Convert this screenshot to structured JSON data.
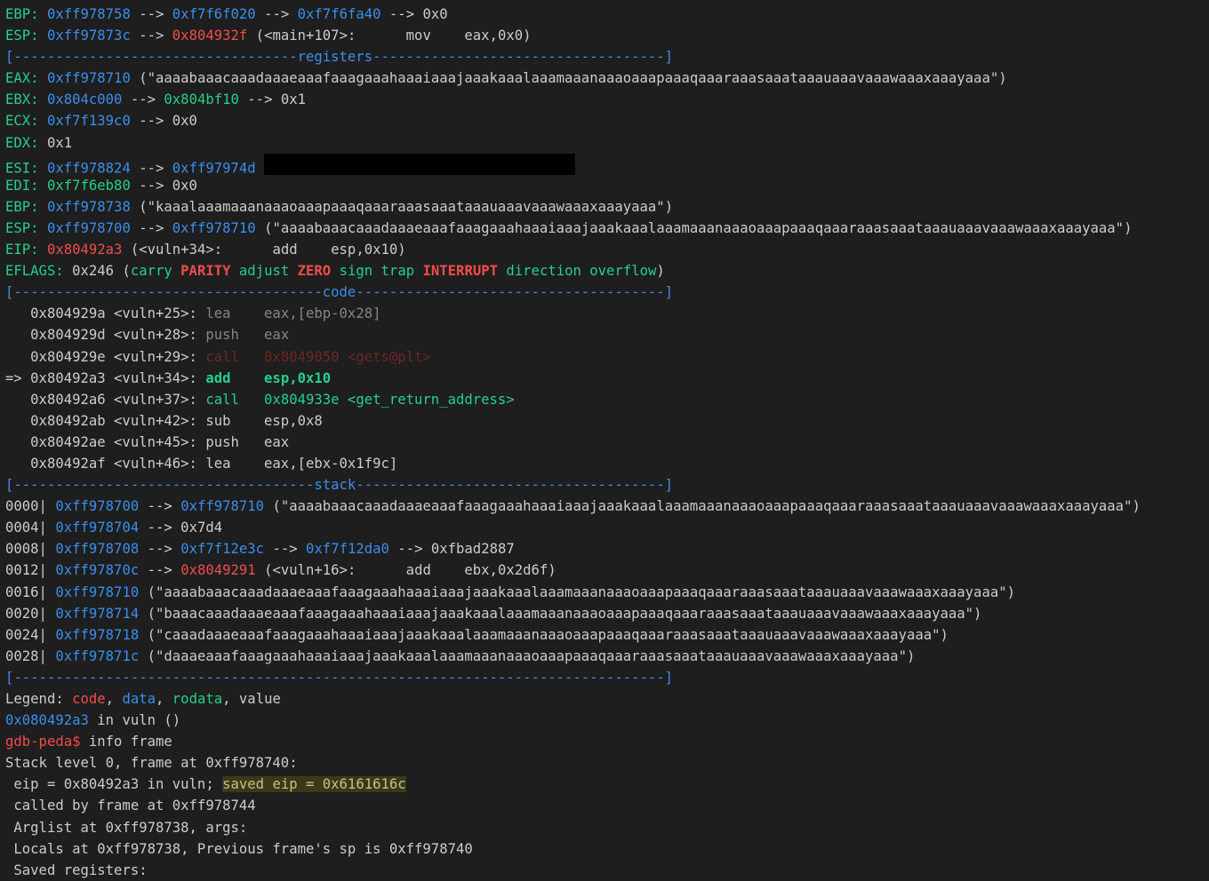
{
  "lines": [
    {
      "name": "ebp-chain",
      "interactable": false,
      "spans": [
        {
          "t": "EBP: ",
          "c": "label"
        },
        {
          "t": "0xff978758",
          "c": "blue"
        },
        {
          "t": " --> ",
          "c": "plain"
        },
        {
          "t": "0xf7f6f020",
          "c": "blue"
        },
        {
          "t": " --> ",
          "c": "plain"
        },
        {
          "t": "0xf7f6fa40",
          "c": "blue"
        },
        {
          "t": " --> 0x0",
          "c": "plain"
        }
      ]
    },
    {
      "name": "esp-chain",
      "interactable": false,
      "spans": [
        {
          "t": "ESP: ",
          "c": "label"
        },
        {
          "t": "0xff97873c",
          "c": "blue"
        },
        {
          "t": " --> ",
          "c": "plain"
        },
        {
          "t": "0x804932f",
          "c": "red"
        },
        {
          "t": " (<main+107>:      mov    eax,0x0)",
          "c": "plain"
        }
      ]
    },
    {
      "name": "registers-header",
      "interactable": false,
      "spans": [
        {
          "t": "[----------------------------------registers-----------------------------------]",
          "c": "blue"
        }
      ]
    },
    {
      "name": "reg-eax",
      "interactable": false,
      "spans": [
        {
          "t": "EAX: ",
          "c": "label"
        },
        {
          "t": "0xff978710",
          "c": "blue"
        },
        {
          "t": " (\"aaaabaaacaaadaaaeaaafaaagaaahaaaiaaajaaakaaalaaamaaanaaaoaaapaaaqaaaraaasaaataaauaaavaaawaaaxaaayaaa\")",
          "c": "plain"
        }
      ]
    },
    {
      "name": "reg-ebx",
      "interactable": false,
      "spans": [
        {
          "t": "EBX: ",
          "c": "label"
        },
        {
          "t": "0x804c000",
          "c": "blue"
        },
        {
          "t": " --> ",
          "c": "plain"
        },
        {
          "t": "0x804bf10",
          "c": "green"
        },
        {
          "t": " --> 0x1",
          "c": "plain"
        }
      ]
    },
    {
      "name": "reg-ecx",
      "interactable": false,
      "spans": [
        {
          "t": "ECX: ",
          "c": "label"
        },
        {
          "t": "0xf7f139c0",
          "c": "blue"
        },
        {
          "t": " --> 0x0",
          "c": "plain"
        }
      ]
    },
    {
      "name": "reg-edx",
      "interactable": false,
      "spans": [
        {
          "t": "EDX: ",
          "c": "label"
        },
        {
          "t": "0x1",
          "c": "plain"
        }
      ]
    },
    {
      "name": "reg-esi",
      "interactable": false,
      "spans": [
        {
          "t": "ESI: ",
          "c": "label"
        },
        {
          "t": "0xff978824",
          "c": "blue"
        },
        {
          "t": " --> ",
          "c": "plain"
        },
        {
          "t": "0xff97974d",
          "c": "blue"
        },
        {
          "t": " ",
          "c": "plain"
        },
        {
          "redact": true
        }
      ]
    },
    {
      "name": "reg-edi",
      "interactable": false,
      "spans": [
        {
          "t": "EDI: ",
          "c": "label"
        },
        {
          "t": "0xf7f6eb80",
          "c": "green"
        },
        {
          "t": " --> 0x0",
          "c": "plain"
        }
      ]
    },
    {
      "name": "reg-ebp",
      "interactable": false,
      "spans": [
        {
          "t": "EBP: ",
          "c": "label"
        },
        {
          "t": "0xff978738",
          "c": "blue"
        },
        {
          "t": " (\"kaaalaaamaaanaaaoaaapaaaqaaaraaasaaataaauaaavaaawaaaxaaayaaa\")",
          "c": "plain"
        }
      ]
    },
    {
      "name": "reg-esp",
      "interactable": false,
      "spans": [
        {
          "t": "ESP: ",
          "c": "label"
        },
        {
          "t": "0xff978700",
          "c": "blue"
        },
        {
          "t": " --> ",
          "c": "plain"
        },
        {
          "t": "0xff978710",
          "c": "blue"
        },
        {
          "t": " (\"aaaabaaacaaadaaaeaaafaaagaaahaaaiaaajaaakaaalaaamaaanaaaoaaapaaaqaaaraaasaaataaauaaavaaawaaaxaaayaaa\")",
          "c": "plain"
        }
      ]
    },
    {
      "name": "reg-eip",
      "interactable": false,
      "spans": [
        {
          "t": "EIP: ",
          "c": "label"
        },
        {
          "t": "0x80492a3",
          "c": "red"
        },
        {
          "t": " (<vuln+34>:      add    esp,0x10)",
          "c": "plain"
        }
      ]
    },
    {
      "name": "reg-eflags",
      "interactable": false,
      "spans": [
        {
          "t": "EFLAGS: ",
          "c": "label"
        },
        {
          "t": "0x246 (",
          "c": "plain"
        },
        {
          "t": "carry",
          "c": "green"
        },
        {
          "t": " ",
          "c": "plain"
        },
        {
          "t": "PARITY",
          "c": "bold-red"
        },
        {
          "t": " ",
          "c": "plain"
        },
        {
          "t": "adjust",
          "c": "green"
        },
        {
          "t": " ",
          "c": "plain"
        },
        {
          "t": "ZERO",
          "c": "bold-red"
        },
        {
          "t": " ",
          "c": "plain"
        },
        {
          "t": "sign",
          "c": "green"
        },
        {
          "t": " ",
          "c": "plain"
        },
        {
          "t": "trap",
          "c": "green"
        },
        {
          "t": " ",
          "c": "plain"
        },
        {
          "t": "INTERRUPT",
          "c": "bold-red"
        },
        {
          "t": " ",
          "c": "plain"
        },
        {
          "t": "direction",
          "c": "green"
        },
        {
          "t": " ",
          "c": "plain"
        },
        {
          "t": "overflow",
          "c": "green"
        },
        {
          "t": ")",
          "c": "plain"
        }
      ]
    },
    {
      "name": "code-header",
      "interactable": false,
      "spans": [
        {
          "t": "[-------------------------------------code-------------------------------------]",
          "c": "blue"
        }
      ]
    },
    {
      "name": "code-line",
      "interactable": false,
      "spans": [
        {
          "t": "   0x804929a <vuln+25>: ",
          "c": "plain"
        },
        {
          "t": "lea    eax,[ebp-0x28]",
          "c": "gray"
        }
      ]
    },
    {
      "name": "code-line",
      "interactable": false,
      "spans": [
        {
          "t": "   0x804929d <vuln+28>: ",
          "c": "plain"
        },
        {
          "t": "push   eax",
          "c": "gray"
        }
      ]
    },
    {
      "name": "code-line",
      "interactable": false,
      "spans": [
        {
          "t": "   0x804929e <vuln+29>: ",
          "c": "plain"
        },
        {
          "t": "call   0x8049050 <gets@plt>",
          "c": "dim-red"
        }
      ]
    },
    {
      "name": "code-line-current",
      "interactable": false,
      "spans": [
        {
          "t": "=> 0x80492a3 <vuln+34>: ",
          "c": "plain"
        },
        {
          "t": "add    esp,0x10",
          "c": "bold-green"
        }
      ]
    },
    {
      "name": "code-line",
      "interactable": false,
      "spans": [
        {
          "t": "   0x80492a6 <vuln+37>: ",
          "c": "plain"
        },
        {
          "t": "call   0x804933e <get_return_address>",
          "c": "green"
        }
      ]
    },
    {
      "name": "code-line",
      "interactable": false,
      "spans": [
        {
          "t": "   0x80492ab <vuln+42>: sub    esp,0x8",
          "c": "plain"
        }
      ]
    },
    {
      "name": "code-line",
      "interactable": false,
      "spans": [
        {
          "t": "   0x80492ae <vuln+45>: push   eax",
          "c": "plain"
        }
      ]
    },
    {
      "name": "code-line",
      "interactable": false,
      "spans": [
        {
          "t": "   0x80492af <vuln+46>: lea    eax,[ebx-0x1f9c]",
          "c": "plain"
        }
      ]
    },
    {
      "name": "stack-header",
      "interactable": false,
      "spans": [
        {
          "t": "[------------------------------------stack-------------------------------------]",
          "c": "blue"
        }
      ]
    },
    {
      "name": "stack-line",
      "interactable": false,
      "spans": [
        {
          "t": "0000| ",
          "c": "plain"
        },
        {
          "t": "0xff978700",
          "c": "blue"
        },
        {
          "t": " --> ",
          "c": "plain"
        },
        {
          "t": "0xff978710",
          "c": "blue"
        },
        {
          "t": " (\"aaaabaaacaaadaaaeaaafaaagaaahaaaiaaajaaakaaalaaamaaanaaaoaaapaaaqaaaraaasaaataaauaaavaaawaaaxaaayaaa\")",
          "c": "plain"
        }
      ]
    },
    {
      "name": "stack-line",
      "interactable": false,
      "spans": [
        {
          "t": "0004| ",
          "c": "plain"
        },
        {
          "t": "0xff978704",
          "c": "blue"
        },
        {
          "t": " --> 0x7d4",
          "c": "plain"
        }
      ]
    },
    {
      "name": "stack-line",
      "interactable": false,
      "spans": [
        {
          "t": "0008| ",
          "c": "plain"
        },
        {
          "t": "0xff978708",
          "c": "blue"
        },
        {
          "t": " --> ",
          "c": "plain"
        },
        {
          "t": "0xf7f12e3c",
          "c": "blue"
        },
        {
          "t": " --> ",
          "c": "plain"
        },
        {
          "t": "0xf7f12da0",
          "c": "blue"
        },
        {
          "t": " --> 0xfbad2887",
          "c": "plain"
        }
      ]
    },
    {
      "name": "stack-line",
      "interactable": false,
      "spans": [
        {
          "t": "0012| ",
          "c": "plain"
        },
        {
          "t": "0xff97870c",
          "c": "blue"
        },
        {
          "t": " --> ",
          "c": "plain"
        },
        {
          "t": "0x8049291",
          "c": "red"
        },
        {
          "t": " (<vuln+16>:      add    ebx,0x2d6f)",
          "c": "plain"
        }
      ]
    },
    {
      "name": "stack-line",
      "interactable": false,
      "spans": [
        {
          "t": "0016| ",
          "c": "plain"
        },
        {
          "t": "0xff978710",
          "c": "blue"
        },
        {
          "t": " (\"aaaabaaacaaadaaaeaaafaaagaaahaaaiaaajaaakaaalaaamaaanaaaoaaapaaaqaaaraaasaaataaauaaavaaawaaaxaaayaaa\")",
          "c": "plain"
        }
      ]
    },
    {
      "name": "stack-line",
      "interactable": false,
      "spans": [
        {
          "t": "0020| ",
          "c": "plain"
        },
        {
          "t": "0xff978714",
          "c": "blue"
        },
        {
          "t": " (\"baaacaaadaaaeaaafaaagaaahaaaiaaajaaakaaalaaamaaanaaaoaaapaaaqaaaraaasaaataaauaaavaaawaaaxaaayaaa\")",
          "c": "plain"
        }
      ]
    },
    {
      "name": "stack-line",
      "interactable": false,
      "spans": [
        {
          "t": "0024| ",
          "c": "plain"
        },
        {
          "t": "0xff978718",
          "c": "blue"
        },
        {
          "t": " (\"caaadaaaeaaafaaagaaahaaaiaaajaaakaaalaaamaaanaaaoaaapaaaqaaaraaasaaataaauaaavaaawaaaxaaayaaa\")",
          "c": "plain"
        }
      ]
    },
    {
      "name": "stack-line",
      "interactable": false,
      "spans": [
        {
          "t": "0028| ",
          "c": "plain"
        },
        {
          "t": "0xff97871c",
          "c": "blue"
        },
        {
          "t": " (\"daaaeaaafaaagaaahaaaiaaajaaakaaalaaamaaanaaaoaaapaaaqaaaraaasaaataaauaaavaaawaaaxaaayaaa\")",
          "c": "plain"
        }
      ]
    },
    {
      "name": "section-footer",
      "interactable": false,
      "spans": [
        {
          "t": "[------------------------------------------------------------------------------]",
          "c": "blue"
        }
      ]
    },
    {
      "name": "legend",
      "interactable": false,
      "spans": [
        {
          "t": "Legend: ",
          "c": "plain"
        },
        {
          "t": "code",
          "c": "red"
        },
        {
          "t": ", ",
          "c": "plain"
        },
        {
          "t": "data",
          "c": "blue"
        },
        {
          "t": ", ",
          "c": "plain"
        },
        {
          "t": "rodata",
          "c": "green"
        },
        {
          "t": ", value",
          "c": "plain"
        }
      ]
    },
    {
      "name": "current-location",
      "interactable": false,
      "spans": [
        {
          "t": "0x080492a3",
          "c": "blue"
        },
        {
          "t": " in vuln ()",
          "c": "plain"
        }
      ]
    },
    {
      "name": "command-prompt",
      "interactable": true,
      "spans": [
        {
          "t": "gdb-peda$",
          "c": "red"
        },
        {
          "t": " info frame",
          "c": "plain"
        }
      ]
    },
    {
      "name": "frame-output",
      "interactable": false,
      "spans": [
        {
          "t": "Stack level 0, frame at 0xff978740:",
          "c": "plain"
        }
      ]
    },
    {
      "name": "frame-output",
      "interactable": false,
      "spans": [
        {
          "t": " eip = 0x80492a3 in vuln; ",
          "c": "plain"
        },
        {
          "t": "saved eip = 0x6161616c",
          "c": "hl"
        }
      ]
    },
    {
      "name": "frame-output",
      "interactable": false,
      "spans": [
        {
          "t": " called by frame at 0xff978744",
          "c": "plain"
        }
      ]
    },
    {
      "name": "frame-output",
      "interactable": false,
      "spans": [
        {
          "t": " Arglist at 0xff978738, args:",
          "c": "plain"
        }
      ]
    },
    {
      "name": "frame-output",
      "interactable": false,
      "spans": [
        {
          "t": " Locals at 0xff978738, Previous frame's sp is 0xff978740",
          "c": "plain"
        }
      ]
    },
    {
      "name": "frame-output",
      "interactable": false,
      "spans": [
        {
          "t": " Saved registers:",
          "c": "plain"
        }
      ]
    }
  ]
}
